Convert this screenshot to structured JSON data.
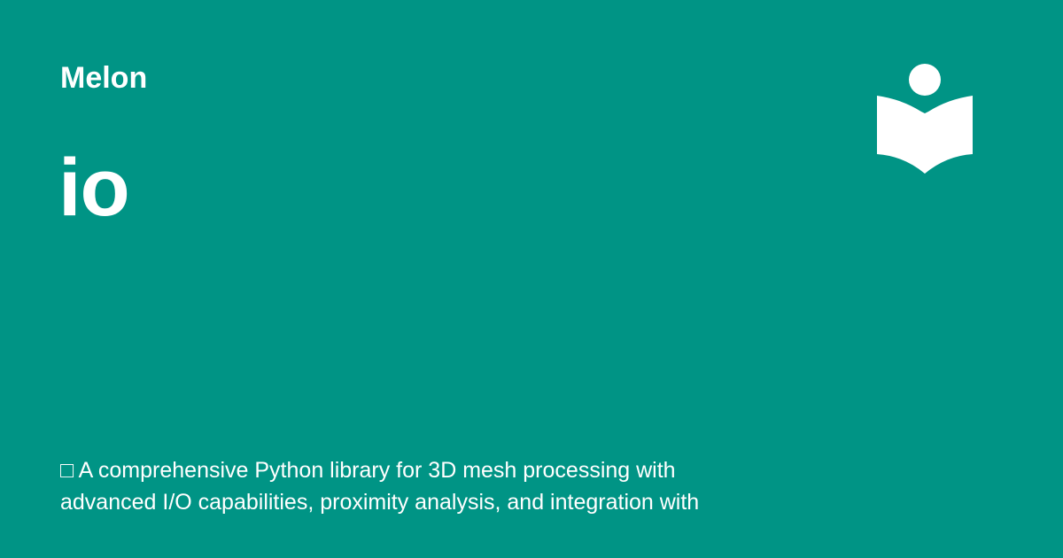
{
  "header": {
    "site_name": "Melon"
  },
  "main": {
    "title": "io",
    "description_lines": [
      "□ A comprehensive Python library for 3D mesh processing with",
      "advanced I/O capabilities, proximity analysis, and integration with"
    ]
  },
  "logo": {
    "icon": "book-reader-icon",
    "color": "#ffffff"
  },
  "theme": {
    "background": "#009485",
    "text": "#ffffff"
  }
}
